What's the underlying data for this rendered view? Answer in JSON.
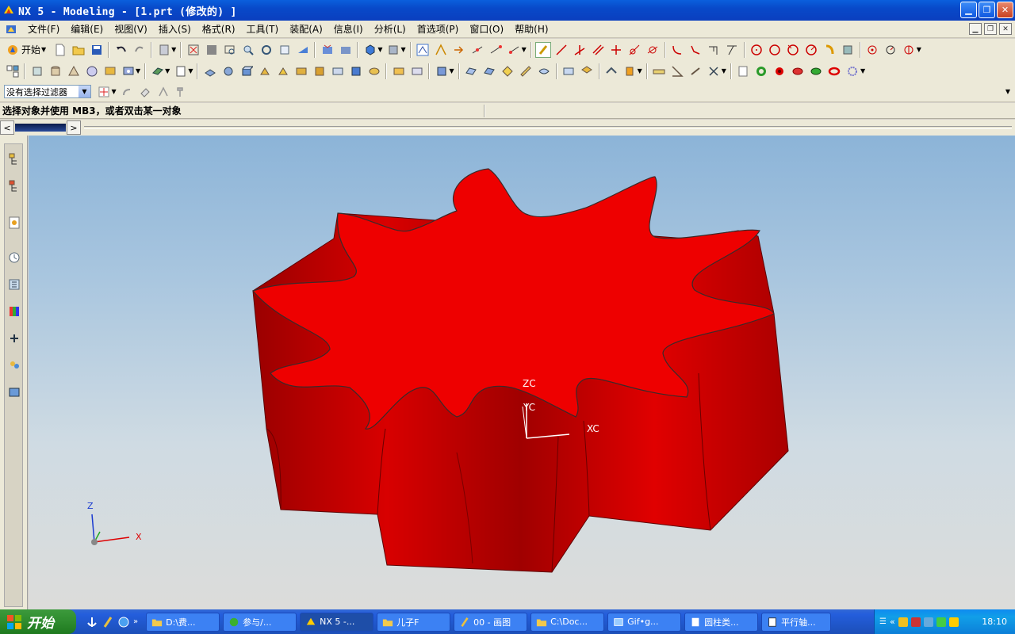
{
  "window": {
    "title": "NX 5 - Modeling - [1.prt  (修改的) ]",
    "controls": [
      "minimize",
      "maximize",
      "close"
    ]
  },
  "menubar": {
    "items": [
      "文件(F)",
      "编辑(E)",
      "视图(V)",
      "插入(S)",
      "格式(R)",
      "工具(T)",
      "装配(A)",
      "信息(I)",
      "分析(L)",
      "首选项(P)",
      "窗口(O)",
      "帮助(H)"
    ]
  },
  "toolbar": {
    "start_label": "开始"
  },
  "selection": {
    "filter_value": "没有选择过滤器"
  },
  "cue": {
    "text": "选择对象并使用 MB3，或者双击某一对象"
  },
  "graphics": {
    "wcs": {
      "zc": "ZC",
      "yc": "YC",
      "xc": "XC"
    },
    "triad": {
      "z": "Z",
      "x": "X"
    },
    "model_color": "#ee0000"
  },
  "taskbar": {
    "start_label": "开始",
    "tasks": [
      {
        "label": "D:\\费...",
        "icon": "folder-icon"
      },
      {
        "label": "参与/...",
        "icon": "chat-icon"
      },
      {
        "label": "NX 5 -...",
        "icon": "nx-icon",
        "active": true
      },
      {
        "label": "儿子F",
        "icon": "folder-icon"
      },
      {
        "label": "00 - 画图",
        "icon": "paint-icon"
      },
      {
        "label": "C:\\Doc...",
        "icon": "folder-icon"
      },
      {
        "label": "Gif•g...",
        "icon": "image-icon"
      },
      {
        "label": "圆柱类...",
        "icon": "doc-icon"
      },
      {
        "label": "平行轴...",
        "icon": "notepad-icon"
      }
    ],
    "clock": "18:10"
  }
}
